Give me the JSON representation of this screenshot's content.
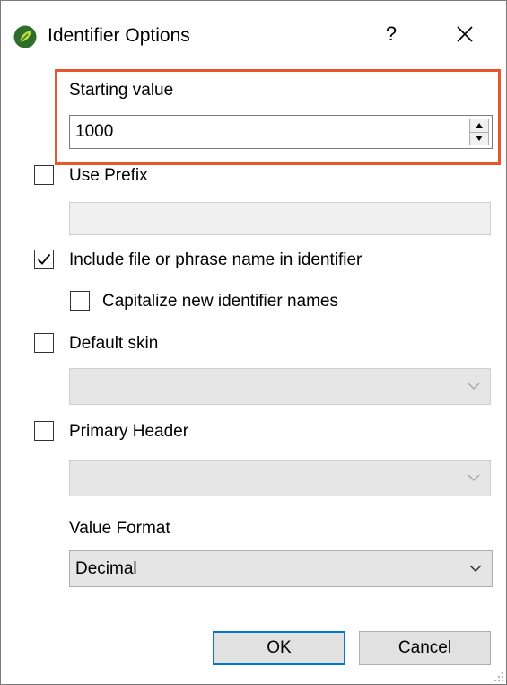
{
  "window": {
    "title": "Identifier Options",
    "help_label": "?",
    "close_icon": "close-icon",
    "app_icon": "leaf-app-icon"
  },
  "starting_value": {
    "label": "Starting value",
    "value": "1000",
    "highlight_color": "#e8552e"
  },
  "use_prefix": {
    "label": "Use Prefix",
    "checked": false,
    "field_value": ""
  },
  "include_name": {
    "label": "Include file or phrase name in identifier",
    "checked": true
  },
  "capitalize": {
    "label": "Capitalize new identifier names",
    "checked": false
  },
  "default_skin": {
    "label": "Default skin",
    "checked": false,
    "selected": ""
  },
  "primary_header": {
    "label": "Primary Header",
    "checked": false,
    "selected": ""
  },
  "value_format": {
    "label": "Value Format",
    "selected": "Decimal"
  },
  "buttons": {
    "ok": "OK",
    "cancel": "Cancel",
    "default_focus_color": "#0078d7"
  }
}
